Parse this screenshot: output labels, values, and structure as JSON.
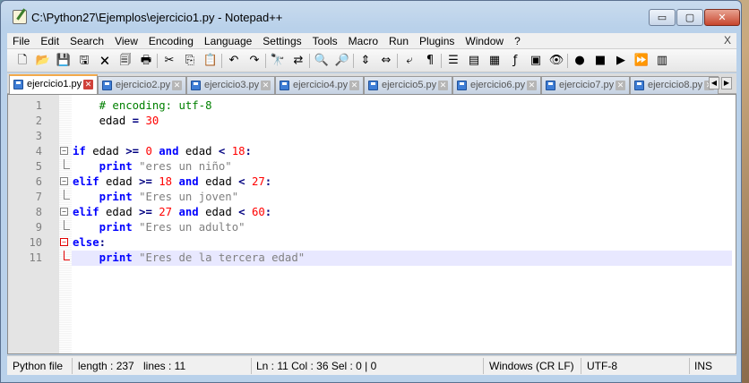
{
  "window": {
    "title": "C:\\Python27\\Ejemplos\\ejercicio1.py - Notepad++"
  },
  "caption": {
    "minimize": "▭",
    "maximize": "▢",
    "close": "✕"
  },
  "menu": [
    "File",
    "Edit",
    "Search",
    "View",
    "Encoding",
    "Language",
    "Settings",
    "Tools",
    "Macro",
    "Run",
    "Plugins",
    "Window",
    "?"
  ],
  "menu_close": "X",
  "toolbar_icons": [
    {
      "name": "new-file-icon",
      "glyph": "🗋"
    },
    {
      "name": "open-file-icon",
      "glyph": "📂"
    },
    {
      "name": "save-icon",
      "glyph": "💾"
    },
    {
      "name": "save-all-icon",
      "glyph": "🖫"
    },
    {
      "name": "close-icon",
      "glyph": "🗙"
    },
    {
      "name": "close-all-icon",
      "glyph": "🗐"
    },
    {
      "name": "print-icon",
      "glyph": "🖶"
    },
    {
      "name": "cut-icon",
      "glyph": "✂"
    },
    {
      "name": "copy-icon",
      "glyph": "⎘"
    },
    {
      "name": "paste-icon",
      "glyph": "📋"
    },
    {
      "name": "undo-icon",
      "glyph": "↶"
    },
    {
      "name": "redo-icon",
      "glyph": "↷"
    },
    {
      "name": "find-icon",
      "glyph": "🔭"
    },
    {
      "name": "replace-icon",
      "glyph": "⇄"
    },
    {
      "name": "zoom-in-icon",
      "glyph": "🔍"
    },
    {
      "name": "zoom-out-icon",
      "glyph": "🔎"
    },
    {
      "name": "sync-vertical-icon",
      "glyph": "⇕"
    },
    {
      "name": "sync-horizontal-icon",
      "glyph": "⇔"
    },
    {
      "name": "word-wrap-icon",
      "glyph": "⤶"
    },
    {
      "name": "show-all-chars-icon",
      "glyph": "¶"
    },
    {
      "name": "indent-guide-icon",
      "glyph": "☰"
    },
    {
      "name": "user-language-icon",
      "glyph": "▤"
    },
    {
      "name": "document-map-icon",
      "glyph": "▦"
    },
    {
      "name": "function-list-icon",
      "glyph": "ƒ"
    },
    {
      "name": "folder-workspace-icon",
      "glyph": "▣"
    },
    {
      "name": "monitoring-icon",
      "glyph": "👁"
    },
    {
      "name": "record-macro-icon",
      "glyph": "●"
    },
    {
      "name": "stop-macro-icon",
      "glyph": "■"
    },
    {
      "name": "play-macro-icon",
      "glyph": "▶"
    },
    {
      "name": "play-macro-multiple-icon",
      "glyph": "⏩"
    },
    {
      "name": "save-macro-icon",
      "glyph": "▥"
    }
  ],
  "tabs": [
    {
      "label": "ejercicio1.py",
      "active": true
    },
    {
      "label": "ejercicio2.py",
      "active": false
    },
    {
      "label": "ejercicio3.py",
      "active": false
    },
    {
      "label": "ejercicio4.py",
      "active": false
    },
    {
      "label": "ejercicio5.py",
      "active": false
    },
    {
      "label": "ejercicio6.py",
      "active": false
    },
    {
      "label": "ejercicio7.py",
      "active": false
    },
    {
      "label": "ejercicio8.py",
      "active": false
    }
  ],
  "tab_nav": {
    "prev": "◀",
    "next": "▶"
  },
  "editor": {
    "current_line": 11,
    "lines": [
      {
        "num": "1",
        "fold": "",
        "tokens": [
          {
            "t": "    ",
            "c": "c-id"
          },
          {
            "t": "# encoding: utf-8",
            "c": "c-comment"
          }
        ]
      },
      {
        "num": "2",
        "fold": "",
        "tokens": [
          {
            "t": "    edad ",
            "c": "c-id"
          },
          {
            "t": "=",
            "c": "c-op"
          },
          {
            "t": " ",
            "c": "c-id"
          },
          {
            "t": "30",
            "c": "c-num"
          }
        ]
      },
      {
        "num": "3",
        "fold": "",
        "tokens": []
      },
      {
        "num": "4",
        "fold": "start",
        "tokens": [
          {
            "t": "if",
            "c": "c-kw"
          },
          {
            "t": " edad ",
            "c": "c-id"
          },
          {
            "t": ">=",
            "c": "c-op"
          },
          {
            "t": " ",
            "c": "c-id"
          },
          {
            "t": "0",
            "c": "c-num"
          },
          {
            "t": " ",
            "c": "c-id"
          },
          {
            "t": "and",
            "c": "c-kw"
          },
          {
            "t": " edad ",
            "c": "c-id"
          },
          {
            "t": "<",
            "c": "c-op"
          },
          {
            "t": " ",
            "c": "c-id"
          },
          {
            "t": "18",
            "c": "c-num"
          },
          {
            "t": ":",
            "c": "c-op"
          }
        ]
      },
      {
        "num": "5",
        "fold": "end",
        "tokens": [
          {
            "t": "    ",
            "c": "c-id"
          },
          {
            "t": "print",
            "c": "c-kw"
          },
          {
            "t": " ",
            "c": "c-id"
          },
          {
            "t": "\"eres un niño\"",
            "c": "c-str"
          }
        ]
      },
      {
        "num": "6",
        "fold": "start",
        "tokens": [
          {
            "t": "elif",
            "c": "c-kw"
          },
          {
            "t": " edad ",
            "c": "c-id"
          },
          {
            "t": ">=",
            "c": "c-op"
          },
          {
            "t": " ",
            "c": "c-id"
          },
          {
            "t": "18",
            "c": "c-num"
          },
          {
            "t": " ",
            "c": "c-id"
          },
          {
            "t": "and",
            "c": "c-kw"
          },
          {
            "t": " edad ",
            "c": "c-id"
          },
          {
            "t": "<",
            "c": "c-op"
          },
          {
            "t": " ",
            "c": "c-id"
          },
          {
            "t": "27",
            "c": "c-num"
          },
          {
            "t": ":",
            "c": "c-op"
          }
        ]
      },
      {
        "num": "7",
        "fold": "end",
        "tokens": [
          {
            "t": "    ",
            "c": "c-id"
          },
          {
            "t": "print",
            "c": "c-kw"
          },
          {
            "t": " ",
            "c": "c-id"
          },
          {
            "t": "\"Eres un joven\"",
            "c": "c-str"
          }
        ]
      },
      {
        "num": "8",
        "fold": "start",
        "tokens": [
          {
            "t": "elif",
            "c": "c-kw"
          },
          {
            "t": " edad ",
            "c": "c-id"
          },
          {
            "t": ">=",
            "c": "c-op"
          },
          {
            "t": " ",
            "c": "c-id"
          },
          {
            "t": "27",
            "c": "c-num"
          },
          {
            "t": " ",
            "c": "c-id"
          },
          {
            "t": "and",
            "c": "c-kw"
          },
          {
            "t": " edad ",
            "c": "c-id"
          },
          {
            "t": "<",
            "c": "c-op"
          },
          {
            "t": " ",
            "c": "c-id"
          },
          {
            "t": "60",
            "c": "c-num"
          },
          {
            "t": ":",
            "c": "c-op"
          }
        ]
      },
      {
        "num": "9",
        "fold": "end",
        "tokens": [
          {
            "t": "    ",
            "c": "c-id"
          },
          {
            "t": "print",
            "c": "c-kw"
          },
          {
            "t": " ",
            "c": "c-id"
          },
          {
            "t": "\"Eres un adulto\"",
            "c": "c-str"
          }
        ]
      },
      {
        "num": "10",
        "fold": "start-red",
        "tokens": [
          {
            "t": "else",
            "c": "c-kw"
          },
          {
            "t": ":",
            "c": "c-op"
          }
        ]
      },
      {
        "num": "11",
        "fold": "end-red",
        "tokens": [
          {
            "t": "    ",
            "c": "c-id"
          },
          {
            "t": "print",
            "c": "c-kw"
          },
          {
            "t": " ",
            "c": "c-id"
          },
          {
            "t": "\"Eres de la tercera edad\"",
            "c": "c-str"
          }
        ]
      }
    ]
  },
  "status": {
    "language": "Python file",
    "length": "length : 237",
    "lines": "lines : 11",
    "position": "Ln : 11    Col : 36    Sel : 0 | 0",
    "eol": "Windows (CR LF)",
    "encoding": "UTF-8",
    "mode": "INS"
  }
}
